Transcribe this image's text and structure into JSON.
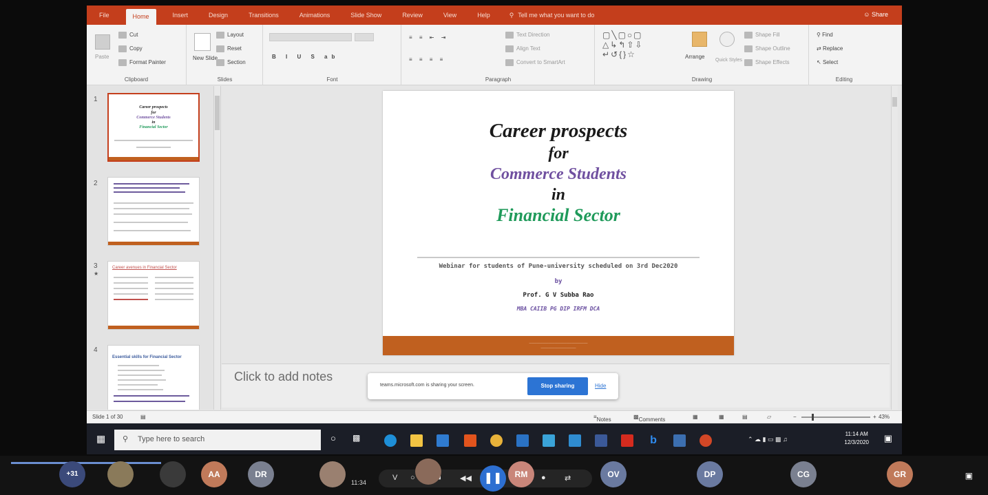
{
  "ribbon": {
    "tabs": [
      "File",
      "Home",
      "Insert",
      "Design",
      "Transitions",
      "Animations",
      "Slide Show",
      "Review",
      "View",
      "Help"
    ],
    "active_tab": "Home",
    "tell_me": "Tell me what you want to do",
    "share": "Share",
    "clipboard": {
      "paste": "Paste",
      "cut": "Cut",
      "copy": "Copy",
      "format_painter": "Format Painter",
      "label": "Clipboard"
    },
    "slides": {
      "new_slide": "New Slide",
      "layout": "Layout",
      "reset": "Reset",
      "section": "Section",
      "label": "Slides"
    },
    "font": {
      "label": "Font"
    },
    "paragraph": {
      "label": "Paragraph",
      "text_direction": "Text Direction",
      "align_text": "Align Text",
      "smartart": "Convert to SmartArt"
    },
    "drawing": {
      "arrange": "Arrange",
      "quick_styles": "Quick Styles",
      "shape_fill": "Shape Fill",
      "shape_outline": "Shape Outline",
      "shape_effects": "Shape Effects",
      "label": "Drawing"
    },
    "editing": {
      "find": "Find",
      "replace": "Replace",
      "select": "Select",
      "label": "Editing"
    }
  },
  "thumbnails": [
    {
      "number": "1",
      "title_lines": [
        "Career prospects",
        "for",
        "Commerce Students",
        "in",
        "Financial Sector"
      ]
    },
    {
      "number": "2"
    },
    {
      "number": "3",
      "title": "Career avenues in Financial Sector"
    },
    {
      "number": "4",
      "title": "Essential skills for Financial Sector"
    }
  ],
  "slide": {
    "title_line1": "Career prospects",
    "title_line2": "for",
    "title_line3": "Commerce Students",
    "title_line4": "in",
    "title_line5": "Financial Sector",
    "subtitle": "Webinar for students of Pune-university scheduled on 3rd Dec2020",
    "by": "by",
    "presenter": "Prof. G V Subba Rao",
    "credentials": "MBA CAIIB PG DIP IRFM DCA"
  },
  "notes": {
    "placeholder": "Click to add notes"
  },
  "share_bar": {
    "message": "teams.microsoft.com is sharing your screen.",
    "stop_label": "Stop sharing",
    "hide_label": "Hide"
  },
  "status_bar": {
    "slide_count": "Slide 1 of 30",
    "notes": "Notes",
    "comments": "Comments",
    "zoom": "43%"
  },
  "taskbar": {
    "search_placeholder": "Type here to search",
    "time": "11:14 AM",
    "date": "12/3/2020"
  },
  "teams": {
    "extra_participants": "+31",
    "elapsed": "11:34",
    "participants": [
      "AA",
      "DR",
      "RM",
      "OV",
      "DP",
      "CG",
      "GR"
    ]
  },
  "colors": {
    "accent": "#c43e1c",
    "title_dark": "#1a1a1a",
    "title_purple": "#7050a0",
    "title_green": "#1f9a5a",
    "footer_band": "#c0601f",
    "teams_blue": "#2c74d4"
  }
}
